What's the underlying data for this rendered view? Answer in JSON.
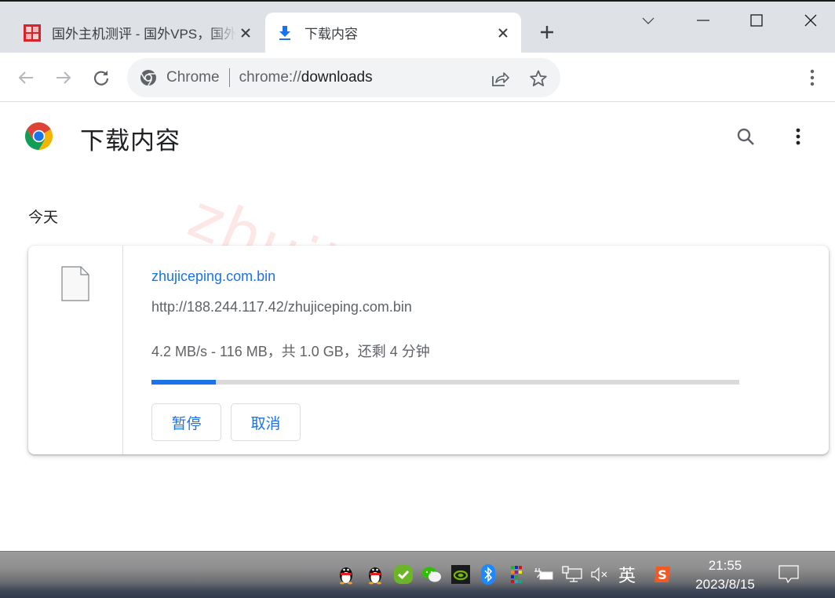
{
  "browser": {
    "tabs": [
      {
        "title": "国外主机测评 - 国外VPS，国外服务器",
        "favicon": "site-seal-icon",
        "active": false
      },
      {
        "title": "下载内容",
        "favicon": "download-icon",
        "active": true
      }
    ],
    "new_tab_label": "+",
    "address_bar": {
      "chip": "Chrome",
      "url_scheme": "chrome://",
      "url_host": "downloads"
    }
  },
  "downloads_page": {
    "title": "下载内容",
    "date_group": "今天",
    "watermark": "zhujiceping.com",
    "items": [
      {
        "file_name": "zhujiceping.com.bin",
        "url": "http://188.244.117.42/zhujiceping.com.bin",
        "status": "4.2 MB/s - 116 MB，共 1.0 GB，还剩 4 分钟",
        "progress_percent": 11,
        "pause_label": "暂停",
        "cancel_label": "取消"
      }
    ]
  },
  "taskbar": {
    "tray_icons": [
      "qq-icon",
      "qq-icon",
      "security-check-icon",
      "wechat-icon",
      "nvidia-icon",
      "bluetooth-icon",
      "color-grid-icon",
      "power-icon",
      "network-icon",
      "volume-muted-icon"
    ],
    "ime_label": "英",
    "time": "21:55",
    "date": "2023/8/15"
  },
  "colors": {
    "accent": "#1a73e8",
    "progress_track": "#dadada",
    "tabstrip": "#dee1e6"
  }
}
